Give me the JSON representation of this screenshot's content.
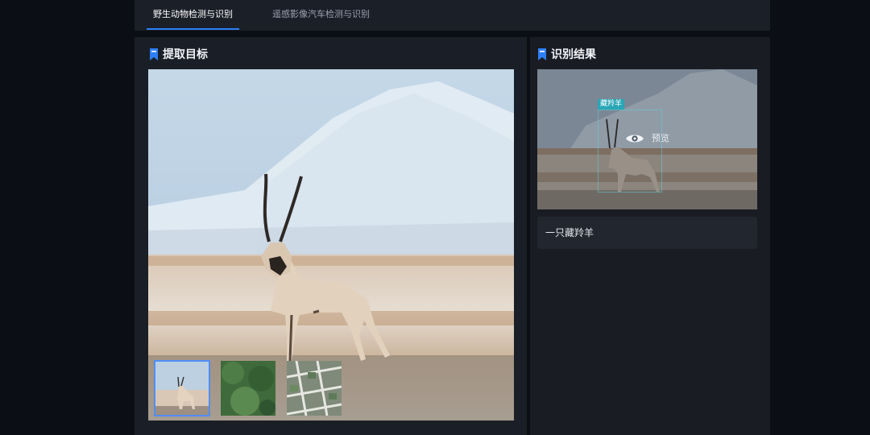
{
  "tabs": [
    {
      "label": "野生动物检测与识别",
      "active": true
    },
    {
      "label": "遥感影像汽车检测与识别",
      "active": false
    }
  ],
  "left_panel": {
    "title": "提取目标",
    "title_icon": "bookmark-icon",
    "main_image": "tibetan-antelope-photo",
    "thumbnails": [
      {
        "name": "antelope-thumbnail",
        "selected": true
      },
      {
        "name": "forest-aerial-thumbnail",
        "selected": false
      },
      {
        "name": "city-aerial-thumbnail",
        "selected": false
      }
    ]
  },
  "right_panel": {
    "title": "识别结果",
    "title_icon": "bookmark-icon",
    "detection_label": "藏羚羊",
    "preview_label": "预览",
    "preview_icon": "eye-icon",
    "result_text": "一只藏羚羊"
  },
  "colors": {
    "accent": "#2d7ff9",
    "detection_label_bg": "#2aa6b6",
    "panel_bg": "#1a1e26",
    "page_bg": "#0b0e14"
  }
}
